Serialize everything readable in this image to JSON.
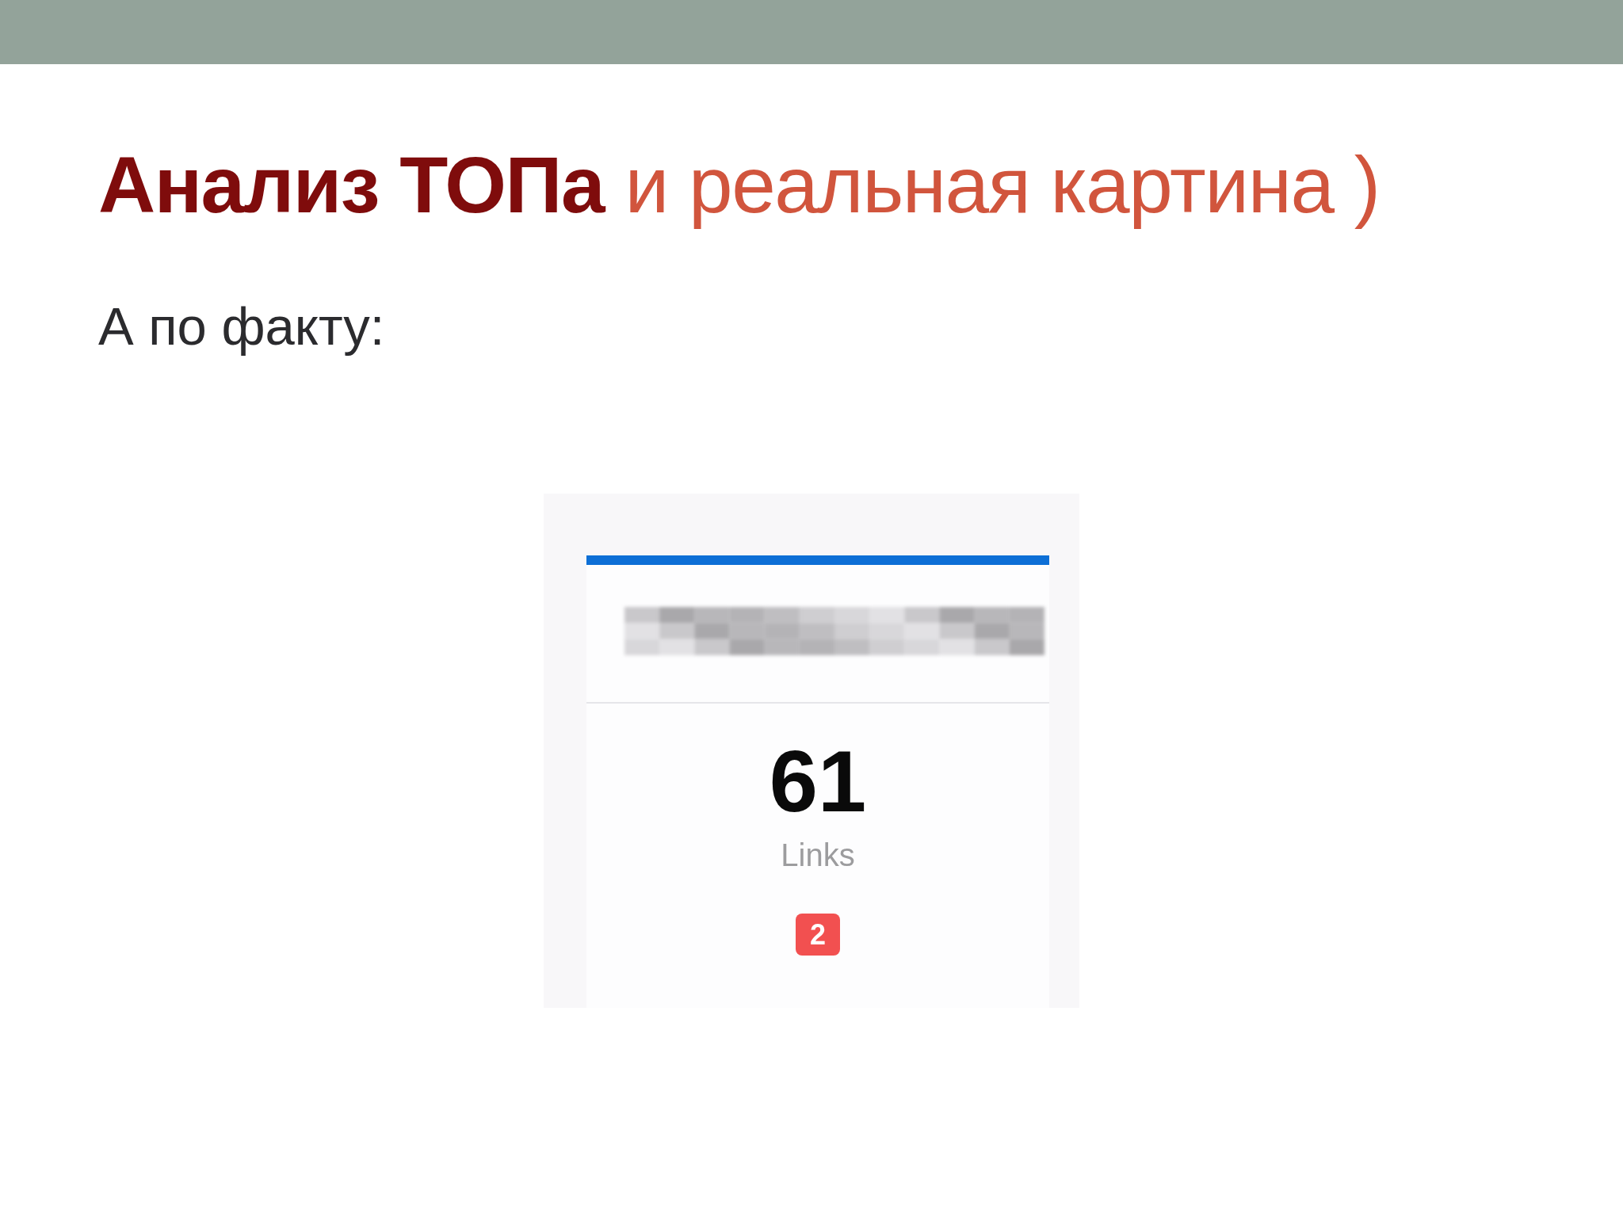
{
  "slide": {
    "title": "**Анализ ТОПа** и реальная картина )",
    "subtitle": "А по факту:"
  },
  "widget": {
    "value": "61",
    "label": "Links",
    "badge": "2"
  }
}
